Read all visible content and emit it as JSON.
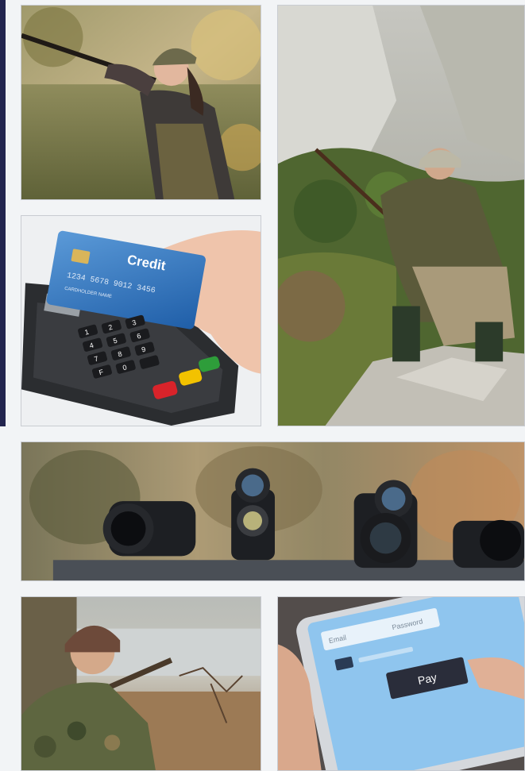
{
  "card": {
    "brand_text": "Credit",
    "number_text": "1234 5678 9012 3456",
    "holder_text": "CARDHOLDER NAME"
  },
  "keypad": {
    "keys": [
      "1",
      "2",
      "3",
      "4",
      "5",
      "6",
      "7",
      "8",
      "9",
      "F",
      "0",
      ""
    ]
  },
  "phone": {
    "field_label_left": "Email",
    "field_label_right": "Password",
    "pay_label": "Pay"
  },
  "colors": {
    "accent_bar": "#23254f",
    "pay_button": "#2a2d3a",
    "key_red": "#d8232a",
    "key_yellow": "#f2c200",
    "key_green": "#2e9d3a"
  }
}
